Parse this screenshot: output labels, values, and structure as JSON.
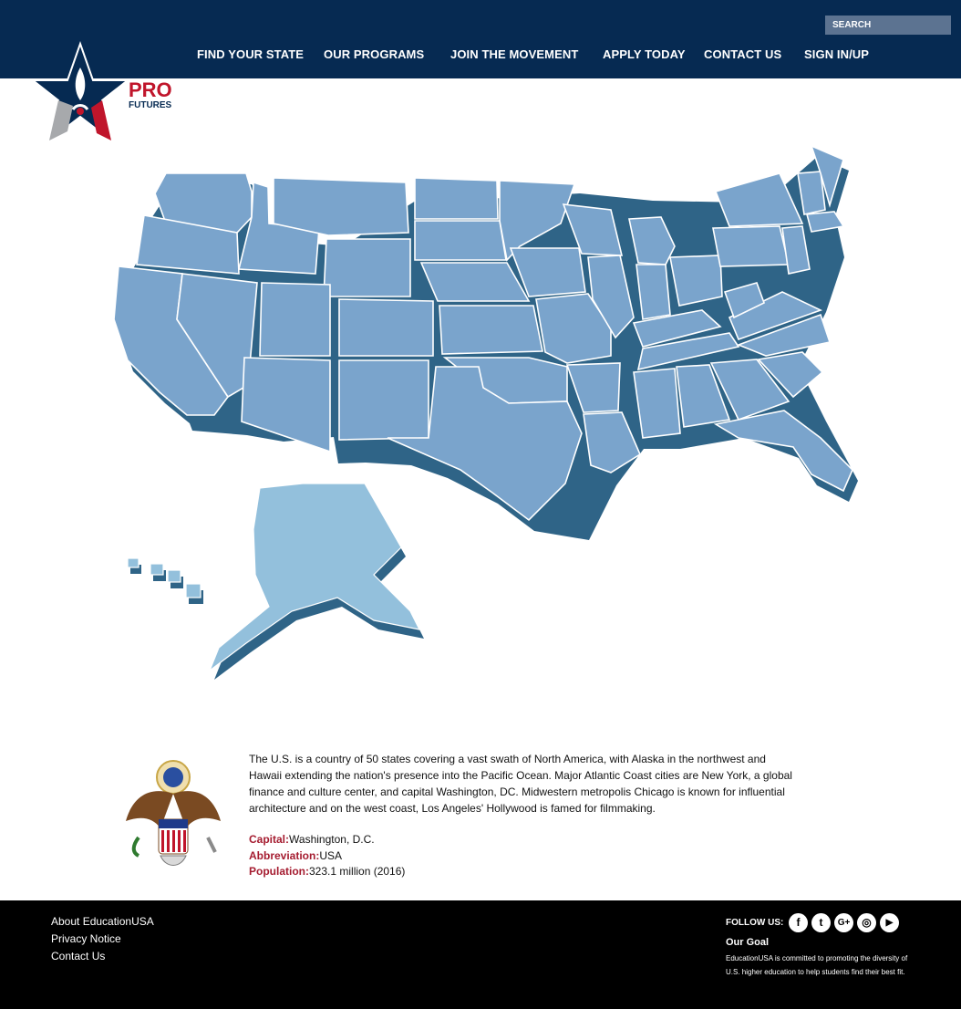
{
  "header": {
    "search_placeholder": "SEARCH",
    "nav": [
      "FIND YOUR STATE",
      "OUR PROGRAMS",
      "JOIN THE MOVEMENT",
      "APPLY TODAY",
      "CONTACT US",
      "SIGN IN/UP"
    ]
  },
  "logo": {
    "pro": "PRO",
    "futures": "FUTURES"
  },
  "intro": {
    "description": "The U.S. is a country of 50 states covering a vast swath of North America, with Alaska in the northwest and Hawaii extending the nation's presence into the Pacific Ocean. Major Atlantic Coast cities are New York, a global finance and culture center, and capital Washington, DC. Midwestern metropolis Chicago is known for influential architecture and on the west coast, Los Angeles' Hollywood is famed for filmmaking.",
    "facts": [
      {
        "label": "Capital:",
        "value": "Washington, D.C."
      },
      {
        "label": "Abbreviation:",
        "value": "USA"
      },
      {
        "label": "Population:",
        "value": "323.1 million (2016)"
      }
    ]
  },
  "footer": {
    "links": [
      "About EducationUSA",
      "Privacy Notice",
      "Contact Us"
    ],
    "follow_label": "FOLLOW US:",
    "social": [
      {
        "icon": "facebook-icon",
        "glyph": "f"
      },
      {
        "icon": "twitter-icon",
        "glyph": "t"
      },
      {
        "icon": "google-plus-icon",
        "glyph": "G+"
      },
      {
        "icon": "instagram-icon",
        "glyph": "◎"
      },
      {
        "icon": "youtube-icon",
        "glyph": "▶"
      }
    ],
    "goal_title": "Our Goal",
    "goal_text": "EducationUSA is committed to promoting the diversity of U.S. higher education to help students find their best fit."
  },
  "colors": {
    "header_bg": "#062a52",
    "accent_red": "#a51c30",
    "map_fill": "#7aa4cc",
    "map_side": "#2f6487",
    "footer_bg": "#000000"
  }
}
